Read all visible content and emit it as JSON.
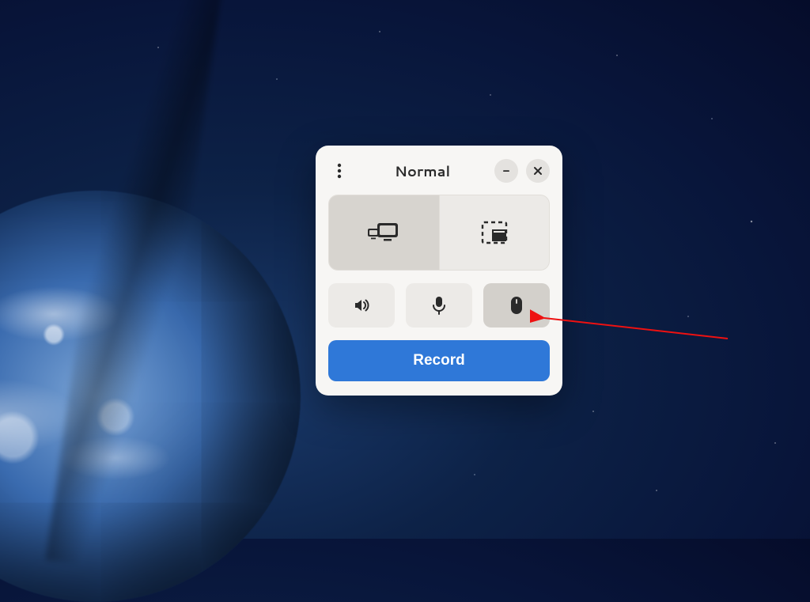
{
  "window": {
    "title": "Normal",
    "capture_modes": {
      "screen_label": "Screen",
      "selection_label": "Selection",
      "active_index": 0
    },
    "toggles": {
      "speaker_on": false,
      "microphone_on": false,
      "mouse_on": true
    },
    "record_button_label": "Record"
  },
  "icons": {
    "menu": "menu-kebab-icon",
    "minimize": "minimize-icon",
    "close": "close-icon",
    "screen": "display-icon",
    "selection": "selection-icon",
    "speaker": "speaker-icon",
    "microphone": "microphone-icon",
    "mouse": "mouse-icon"
  },
  "colors": {
    "accent": "#2f78d8",
    "panel_bg": "#f7f6f4",
    "btn_bg": "#eceae7",
    "btn_active": "#d3d0cb",
    "arrow": "#e11"
  }
}
